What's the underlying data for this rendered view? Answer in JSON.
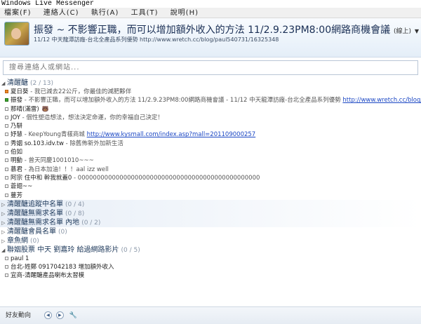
{
  "window": {
    "title": "Windows Live Messenger"
  },
  "menu": [
    "檔案(F)",
    "連絡人(C)",
    "執行(A)",
    "工具(T)",
    "說明(H)"
  ],
  "header": {
    "status_name": "振發 ~ 不影響正職，而可以增加額外收入的方法 11/2.9.23PM8:00網路商機會議",
    "status_tag": "(線上)",
    "personal_message": "11/12  中天龍潭訪廠-台北全產品系列優勢 http://www.wretch.cc/blog/paul540731/16325348"
  },
  "search": {
    "placeholder": "搜尋連絡人或網站..."
  },
  "groups": [
    {
      "name": "清醒醣",
      "count": "(2 / 13)",
      "expanded": true,
      "contacts": [
        {
          "status": "away",
          "name": "夏日葵",
          "message": " - 我已減去22公斤，你最佳的減肥夥伴",
          "link": ""
        },
        {
          "status": "online",
          "name": "振發",
          "message": " - 不影響正職，而可以增加額外收入的方法 11/2.9.23PM8:00網路商機會議 - 11/12  中天龍潭訪廠-台北全產品系列優勢 ",
          "link": "http://www.wretch.cc/blog/"
        },
        {
          "status": "offline",
          "name": "那晴(滿雷)",
          "message": "",
          "link": "",
          "emoticon": "🐻"
        },
        {
          "status": "offline",
          "name": "JOY",
          "message": " - 個性塑造想法，想法決定命運，你的幸福自己決定！",
          "link": ""
        },
        {
          "status": "offline",
          "name": "乃駢",
          "message": "",
          "link": ""
        },
        {
          "status": "offline",
          "name": "妤慧",
          "message": " - KeepYoung青樣商城 ",
          "link": "http://www.kysmall.com/index.asp?mall=201109000257"
        },
        {
          "status": "offline",
          "name": "秀姻 so.103.idv.tw",
          "message": " - 除舊佈新外加新生活",
          "link": ""
        },
        {
          "status": "offline",
          "name": "伯如",
          "message": "",
          "link": ""
        },
        {
          "status": "offline",
          "name": "明動",
          "message": " - 曾天同慶1001010~~~",
          "link": ""
        },
        {
          "status": "offline",
          "name": "慕君",
          "message": " - 為日本加油！！！aal izz well",
          "link": ""
        },
        {
          "status": "offline",
          "name": "阿宗 住中和 幹我就蓋0",
          "message": " - 000000000000000000000000000000000000000000000000",
          "link": ""
        },
        {
          "status": "offline",
          "name": "蒼翅~~",
          "message": "",
          "link": ""
        },
        {
          "status": "offline",
          "name": "蔓芳",
          "message": "",
          "link": ""
        }
      ]
    },
    {
      "name": "清醒醣追蹤中名單",
      "count": "(0 / 4)",
      "expanded": false,
      "contacts": []
    },
    {
      "name": "清醒醣無需求名單",
      "count": "(0 / 8)",
      "expanded": false,
      "contacts": []
    },
    {
      "name": "清醒醣無需求名單 內地",
      "count": "(0 / 2)",
      "expanded": false,
      "contacts": []
    },
    {
      "name": "清醒醣會員名單",
      "count": "(0)",
      "expanded": false,
      "contacts": []
    },
    {
      "name": "章魚網",
      "count": "(0)",
      "expanded": false,
      "contacts": []
    },
    {
      "name": "聯姻股票 中天 劉嘉玲 給過網路影片",
      "count": "(0 / 5)",
      "expanded": true,
      "contacts": [
        {
          "status": "offline",
          "name": "paul 1",
          "message": "",
          "link": ""
        },
        {
          "status": "offline",
          "name": "台北-姓鄭 0917042183 增加額外收入",
          "message": "",
          "link": ""
        },
        {
          "status": "offline",
          "name": "宜商-清醒醣產品喇布太習模",
          "message": "",
          "link": ""
        }
      ]
    }
  ],
  "bottombar": {
    "label": "好友動向"
  },
  "colors": {
    "link": "#1b47c4",
    "group": "#1e395b",
    "away": "#f08a24",
    "online": "#3ba52d"
  }
}
